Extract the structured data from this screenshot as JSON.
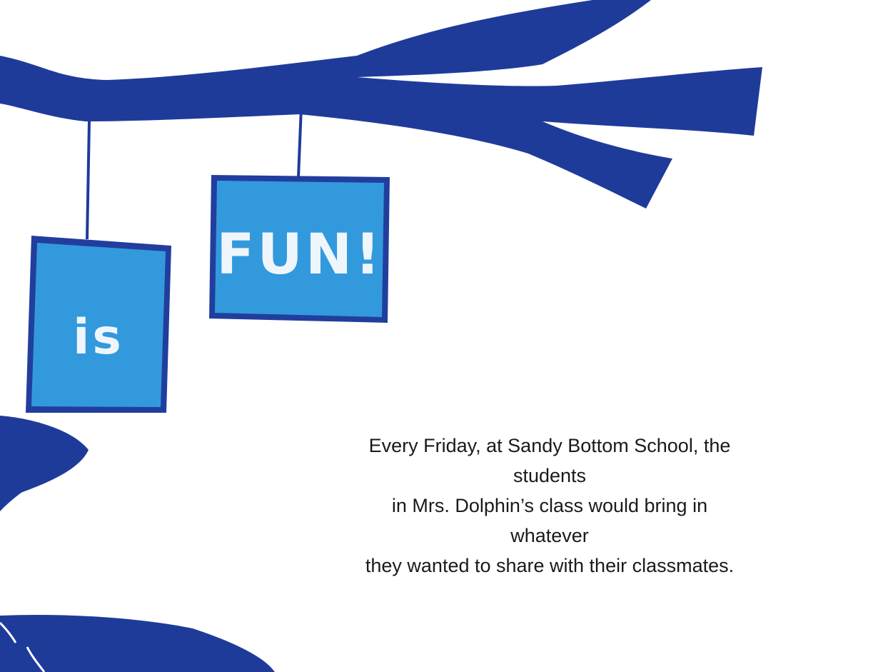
{
  "signs": {
    "left": "is",
    "right": "FUN!"
  },
  "story": {
    "lines": [
      "Every Friday, at Sandy Bottom School, the",
      "students",
      "in Mrs. Dolphin’s class would bring in",
      "whatever",
      "they wanted to share with their classmates."
    ]
  },
  "colors": {
    "branch": "#1f3b9a",
    "sign_border": "#213e9e",
    "sign_fill": "#3399dd",
    "chalk": "#eef6fc",
    "text": "#1a1a1a",
    "background": "#ffffff"
  }
}
